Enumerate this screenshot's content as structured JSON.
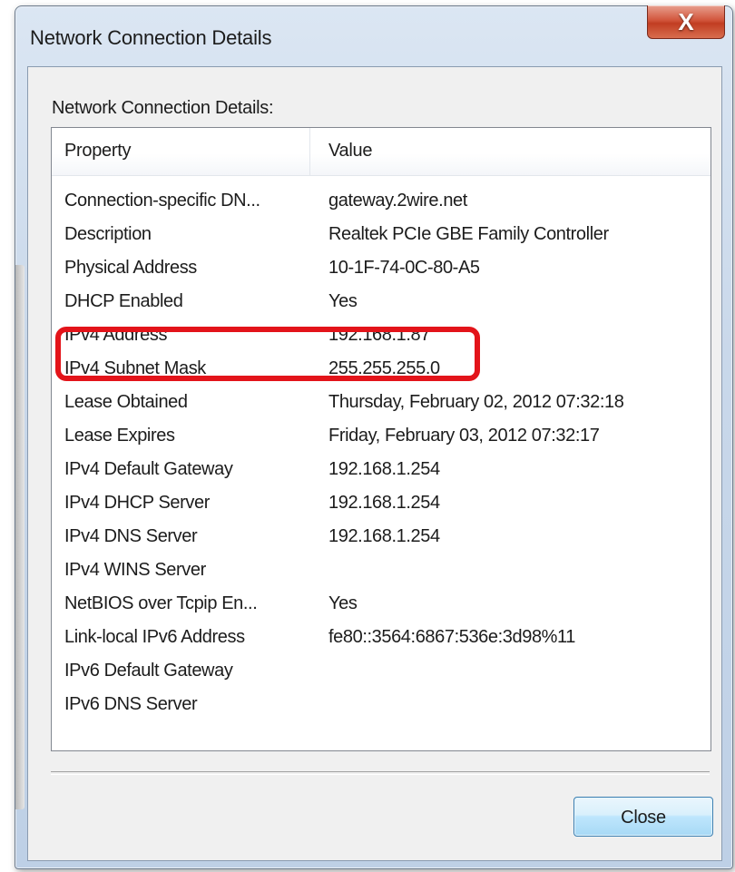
{
  "window": {
    "title": "Network Connection Details",
    "close_glyph": "X"
  },
  "dialog": {
    "group_label": "Network Connection Details:",
    "columns": {
      "property": "Property",
      "value": "Value"
    },
    "rows": [
      {
        "property": "Connection-specific DN...",
        "value": "gateway.2wire.net"
      },
      {
        "property": "Description",
        "value": "Realtek PCIe GBE Family Controller"
      },
      {
        "property": "Physical Address",
        "value": "10-1F-74-0C-80-A5"
      },
      {
        "property": "DHCP Enabled",
        "value": "Yes"
      },
      {
        "property": "IPv4 Address",
        "value": "192.168.1.87"
      },
      {
        "property": "IPv4 Subnet Mask",
        "value": "255.255.255.0"
      },
      {
        "property": "Lease Obtained",
        "value": "Thursday, February 02, 2012 07:32:18"
      },
      {
        "property": "Lease Expires",
        "value": "Friday, February 03, 2012 07:32:17"
      },
      {
        "property": "IPv4 Default Gateway",
        "value": "192.168.1.254"
      },
      {
        "property": "IPv4 DHCP Server",
        "value": "192.168.1.254"
      },
      {
        "property": "IPv4 DNS Server",
        "value": "192.168.1.254"
      },
      {
        "property": "IPv4 WINS Server",
        "value": ""
      },
      {
        "property": "NetBIOS over Tcpip En...",
        "value": "Yes"
      },
      {
        "property": "Link-local IPv6 Address",
        "value": "fe80::3564:6867:536e:3d98%11"
      },
      {
        "property": "IPv6 Default Gateway",
        "value": ""
      },
      {
        "property": "IPv6 DNS Server",
        "value": ""
      }
    ],
    "close_label": "Close"
  },
  "colors": {
    "highlight": "#e3141a",
    "button_border": "#3c7fb1"
  }
}
